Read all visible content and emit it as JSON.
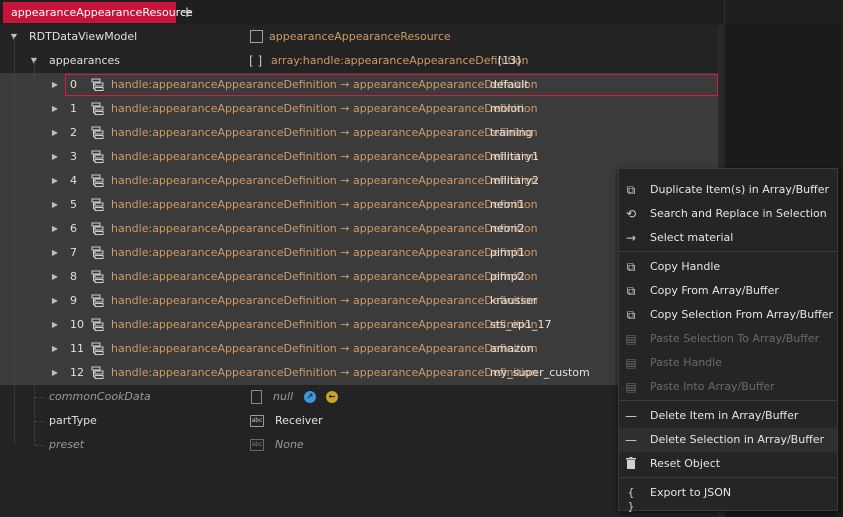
{
  "tab": {
    "title": "appearanceAppearanceResource",
    "add_label": "+"
  },
  "tree": {
    "root": {
      "label": "RDTDataViewModel",
      "value": "appearanceAppearanceResource"
    },
    "appearances": {
      "label": "appearances",
      "type": "array:handle:appearanceAppearanceDefinition",
      "count": "[13]",
      "brackets": "[ ]"
    },
    "handle_type": "handle:appearanceAppearanceDefinition → appearanceAppearanceDefinition",
    "items": [
      {
        "index": "0",
        "value": "default"
      },
      {
        "index": "1",
        "value": "molon"
      },
      {
        "index": "2",
        "value": "training"
      },
      {
        "index": "3",
        "value": "military1"
      },
      {
        "index": "4",
        "value": "military2"
      },
      {
        "index": "5",
        "value": "neon1"
      },
      {
        "index": "6",
        "value": "neon2"
      },
      {
        "index": "7",
        "value": "pimp1"
      },
      {
        "index": "8",
        "value": "pimp2"
      },
      {
        "index": "9",
        "value": "krausser"
      },
      {
        "index": "10",
        "value": "sts_ep1_17"
      },
      {
        "index": "11",
        "value": "amazon"
      },
      {
        "index": "12",
        "value": "my_super_custom"
      }
    ],
    "commonCookData": {
      "label": "commonCookData",
      "value": "null",
      "icon": "json-file-icon"
    },
    "partType": {
      "label": "partType",
      "value": "Receiver",
      "icon": "abc-icon",
      "icon_text": "abc"
    },
    "preset": {
      "label": "preset",
      "value": "None",
      "icon": "abc-icon",
      "icon_text": "abc"
    }
  },
  "context_menu": {
    "items": [
      {
        "label": "Duplicate Item(s) in Array/Buffer",
        "icon": "duplicate-icon",
        "enabled": true
      },
      {
        "label": "Search and Replace in Selection",
        "icon": "search-replace-icon",
        "enabled": true
      },
      {
        "label": "Select material",
        "icon": "arrow-right-icon",
        "enabled": true
      },
      {
        "label": "Copy Handle",
        "icon": "copy-icon",
        "enabled": true
      },
      {
        "label": "Copy From Array/Buffer",
        "icon": "copy-icon",
        "enabled": true
      },
      {
        "label": "Copy Selection From Array/Buffer",
        "icon": "copy-icon",
        "enabled": true
      },
      {
        "label": "Paste Selection To Array/Buffer",
        "icon": "paste-icon",
        "enabled": false
      },
      {
        "label": "Paste Handle",
        "icon": "paste-icon",
        "enabled": false
      },
      {
        "label": "Paste Into Array/Buffer",
        "icon": "paste-icon",
        "enabled": false
      },
      {
        "label": "Delete Item in Array/Buffer",
        "icon": "minus-icon",
        "enabled": true
      },
      {
        "label": "Delete Selection in Array/Buffer",
        "icon": "minus-icon",
        "enabled": true
      },
      {
        "label": "Reset Object",
        "icon": "trash-icon",
        "enabled": true
      },
      {
        "label": "Export to JSON",
        "icon": "braces-icon",
        "enabled": true
      }
    ]
  },
  "colors": {
    "accent": "#c8143b",
    "type_text": "#d19a66",
    "selection_border": "#d41e3c",
    "background": "#232323"
  }
}
